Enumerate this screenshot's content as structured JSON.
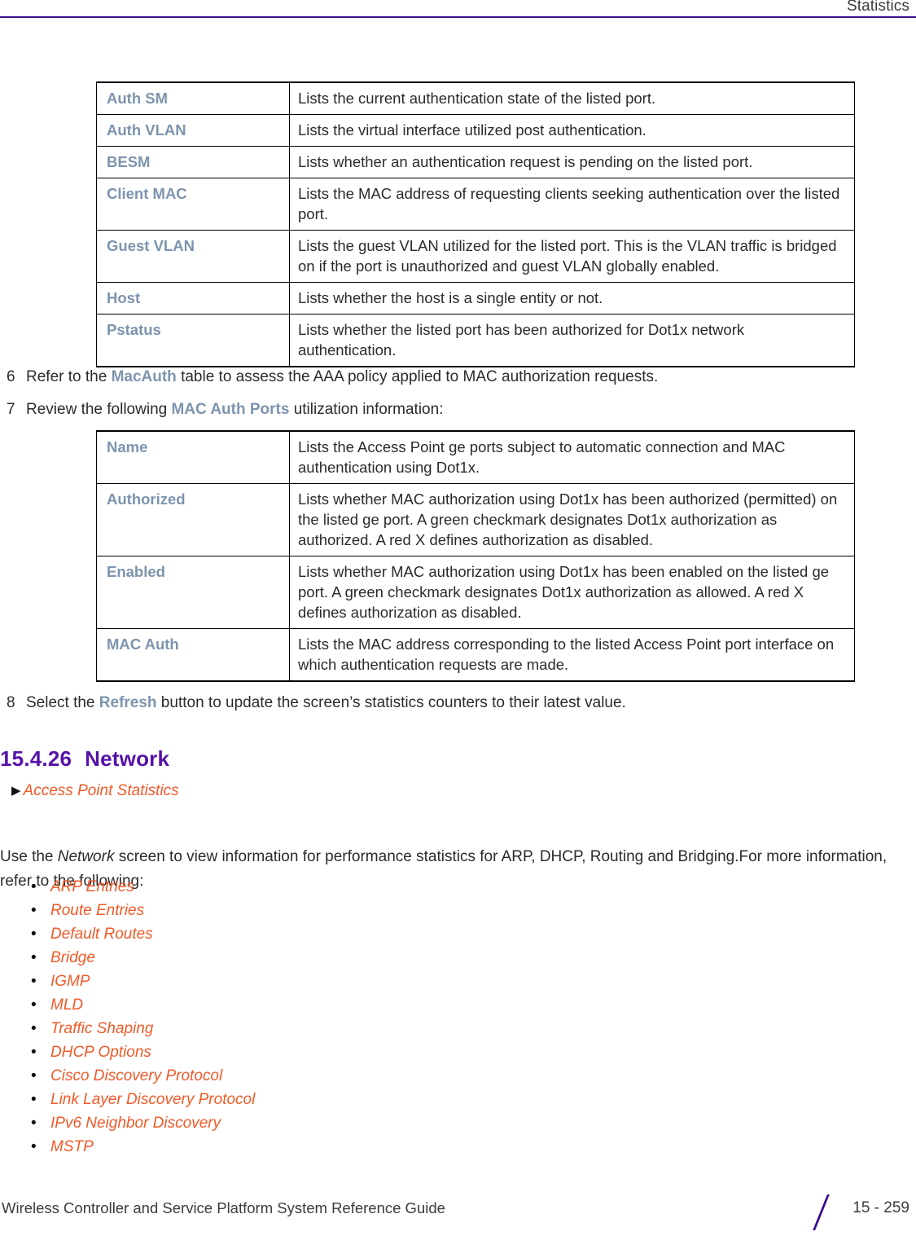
{
  "header": {
    "title": "Statistics"
  },
  "auth_table": {
    "rows": [
      {
        "term": "Auth SM",
        "desc": "Lists the current authentication state of the listed port."
      },
      {
        "term": "Auth VLAN",
        "desc": "Lists the virtual interface utilized post authentication."
      },
      {
        "term": "BESM",
        "desc": "Lists whether an authentication request is pending on the listed port."
      },
      {
        "term": "Client MAC",
        "desc": "Lists the MAC address of requesting clients seeking authentication over the listed port."
      },
      {
        "term": "Guest VLAN",
        "desc": "Lists the guest VLAN utilized for the listed port. This is the VLAN traffic is bridged on if the port is unauthorized and guest VLAN globally enabled."
      },
      {
        "term": "Host",
        "desc": "Lists whether the host is a single entity or not."
      },
      {
        "term": "Pstatus",
        "desc": "Lists whether the listed port has been authorized for Dot1x network authentication."
      }
    ]
  },
  "step6": {
    "number": "6",
    "text_before": "Refer to the ",
    "ref": "MacAuth",
    "text_after": " table to assess the AAA policy applied to MAC authorization requests."
  },
  "step7": {
    "number": "7",
    "text_before": "Review the following ",
    "ref": "MAC Auth Ports",
    "text_after": " utilization information:"
  },
  "macauth_table": {
    "rows": [
      {
        "term": "Name",
        "desc": "Lists the Access Point ge ports subject to automatic connection and MAC authentication using Dot1x."
      },
      {
        "term": "Authorized",
        "desc": "Lists whether MAC authorization using Dot1x has been authorized (permitted) on the listed ge port. A green checkmark designates Dot1x authorization as authorized. A red X defines authorization as disabled."
      },
      {
        "term": "Enabled",
        "desc": "Lists whether MAC authorization using Dot1x has been enabled on the listed ge port. A green checkmark designates Dot1x authorization as allowed. A red X defines authorization as disabled."
      },
      {
        "term": "MAC Auth",
        "desc": "Lists the MAC address corresponding to the listed Access Point port interface on which authentication requests are made."
      }
    ]
  },
  "step8": {
    "number": "8",
    "text_before": "Select the ",
    "ref": "Refresh",
    "text_after": " button to update the screen’s statistics counters to their latest value."
  },
  "section": {
    "number": "15.4.26",
    "title": "Network",
    "breadcrumb": "Access Point Statistics",
    "breadcrumb_marker": "▶"
  },
  "intro": {
    "text_before": "Use the ",
    "italic": "Network",
    "text_after": " screen to view information for performance statistics for ARP, DHCP, Routing and Bridging.For more information, refer to the following:"
  },
  "links": {
    "bullet_glyph": "•",
    "items": [
      "ARP Entries",
      "Route Entries",
      "Default Routes",
      "Bridge",
      "IGMP",
      "MLD",
      "Traffic Shaping",
      "DHCP Options",
      "Cisco Discovery Protocol",
      "Link Layer Discovery Protocol",
      "IPv6 Neighbor Discovery",
      "MSTP"
    ]
  },
  "footer": {
    "guide_title": "Wireless Controller and Service Platform System Reference Guide",
    "page_number": "15 - 259"
  },
  "colors": {
    "accent_purple": "#3B0E90",
    "heading_purple": "#5611A8",
    "term_blue": "#7D94AE",
    "link_orange": "#F15A29"
  }
}
